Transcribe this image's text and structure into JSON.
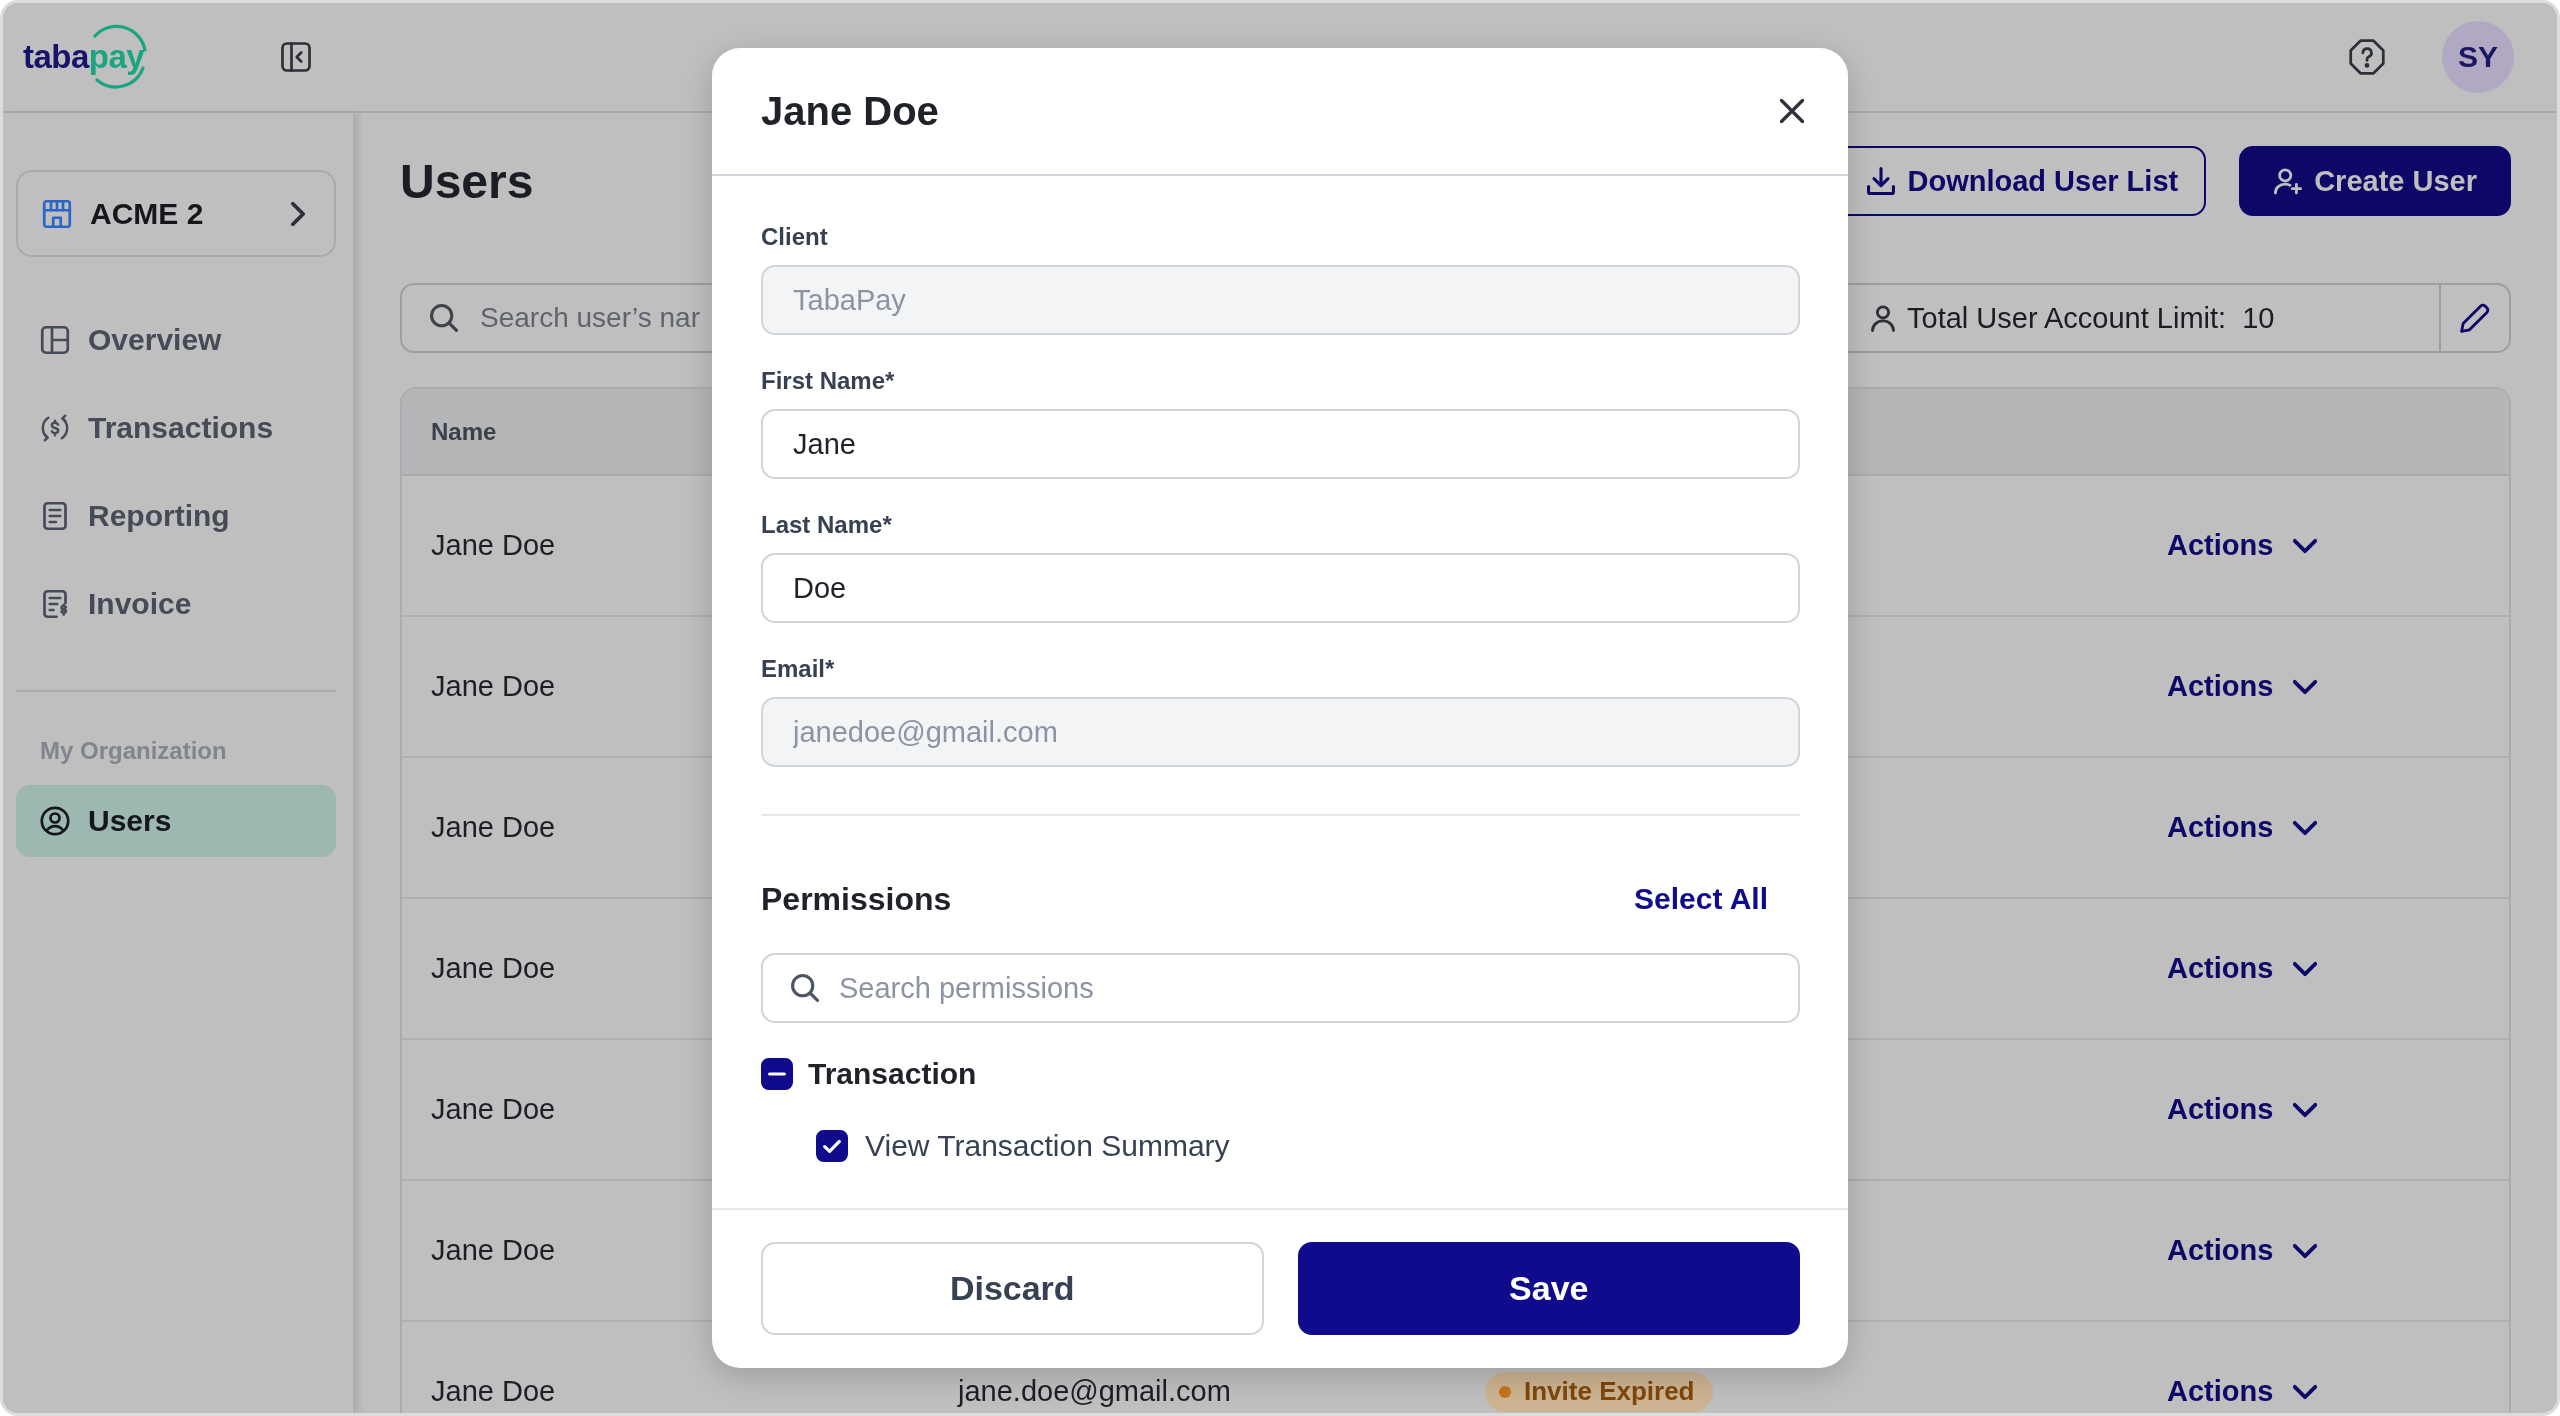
{
  "topbar": {
    "logo": [
      "taba",
      "pay"
    ],
    "avatar": "SY"
  },
  "sidebar": {
    "org_switcher": "ACME 2",
    "nav": [
      {
        "label": "Overview",
        "selected": false
      },
      {
        "label": "Transactions",
        "selected": false
      },
      {
        "label": "Reporting",
        "selected": false
      },
      {
        "label": "Invoice",
        "selected": false
      }
    ],
    "section": {
      "title": "My Organization",
      "items": [
        {
          "label": "Users",
          "selected": true
        }
      ]
    }
  },
  "page": {
    "title": "Users",
    "actions": [
      {
        "label": "Download User List",
        "kind": "outline"
      },
      {
        "label": "Create User",
        "kind": "primary"
      }
    ],
    "search": {
      "placeholder": "Search user’s nar"
    },
    "account_limit": {
      "label": "Total User Account Limit:",
      "value": "10"
    }
  },
  "table": {
    "columns": [
      {
        "label": "Name"
      }
    ],
    "rows": [
      {
        "name": "Jane Doe",
        "action": "Actions"
      },
      {
        "name": "Jane Doe",
        "action": "Actions"
      },
      {
        "name": "Jane Doe",
        "action": "Actions"
      },
      {
        "name": "Jane Doe",
        "action": "Actions"
      },
      {
        "name": "Jane Doe",
        "action": "Actions"
      },
      {
        "name": "Jane Doe",
        "action": "Actions"
      },
      {
        "name": "Jane Doe",
        "email": "jane.doe@gmail.com",
        "status": {
          "label": "Invite Expired",
          "color": "#c5741b"
        },
        "action": "Actions"
      }
    ]
  },
  "modal": {
    "title": "Jane Doe",
    "fields": [
      {
        "label": "Client",
        "value": "TabaPay",
        "disabled": true
      },
      {
        "label": "First Name*",
        "value": "Jane",
        "disabled": false
      },
      {
        "label": "Last Name*",
        "value": "Doe",
        "disabled": false
      },
      {
        "label": "Email*",
        "value": "janedoe@gmail.com",
        "disabled": true
      }
    ],
    "permissions": {
      "title": "Permissions",
      "select_all": "Select All",
      "search": {
        "placeholder": "Search permissions"
      },
      "groups": [
        {
          "label": "Transaction",
          "checked": false,
          "indeterminate": true,
          "children": [
            {
              "label": "View Transaction Summary",
              "checked": true
            }
          ]
        }
      ]
    },
    "buttons": [
      {
        "label": "Discard",
        "kind": "secondary"
      },
      {
        "label": "Save",
        "kind": "primary"
      }
    ]
  }
}
